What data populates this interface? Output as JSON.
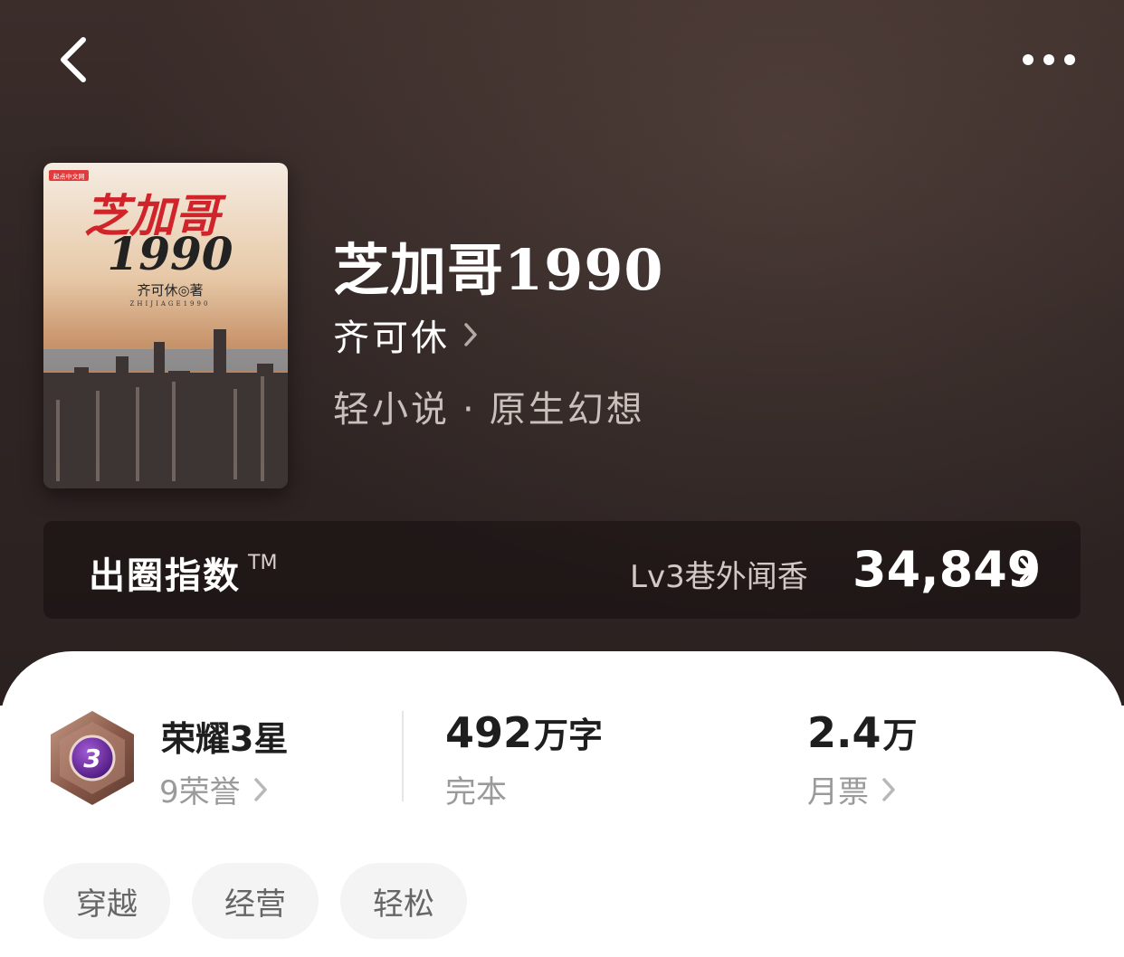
{
  "header": {
    "back_icon": "chevron-left-icon",
    "more_icon": "more-dots-icon"
  },
  "book": {
    "cover": {
      "publisher_badge": "起点中文网",
      "title_line1": "芝加哥",
      "title_line2": "1990",
      "author_sign": "齐可休◎著",
      "pinyin": "ZHIJIAGE1990"
    },
    "title": "芝加哥1990",
    "author": "齐可休",
    "category": "轻小说",
    "subcategory": "原生幻想",
    "separator": "·"
  },
  "index": {
    "label": "出圈指数",
    "tm": "TM",
    "level": "Lv3巷外闻香",
    "value": "34,849"
  },
  "stats": {
    "honor": {
      "badge_number": "3",
      "title": "荣耀3星",
      "count": "9荣誉"
    },
    "words": {
      "value": "492",
      "unit": "万字",
      "label": "完本"
    },
    "tickets": {
      "value": "2.4",
      "unit": "万",
      "label": "月票"
    }
  },
  "tags": [
    "穿越",
    "经营",
    "轻松"
  ],
  "colors": {
    "hero_bg": "#2f2524",
    "badge_purple": "#5a1e8c",
    "badge_bronze": "#8a5a4a"
  }
}
